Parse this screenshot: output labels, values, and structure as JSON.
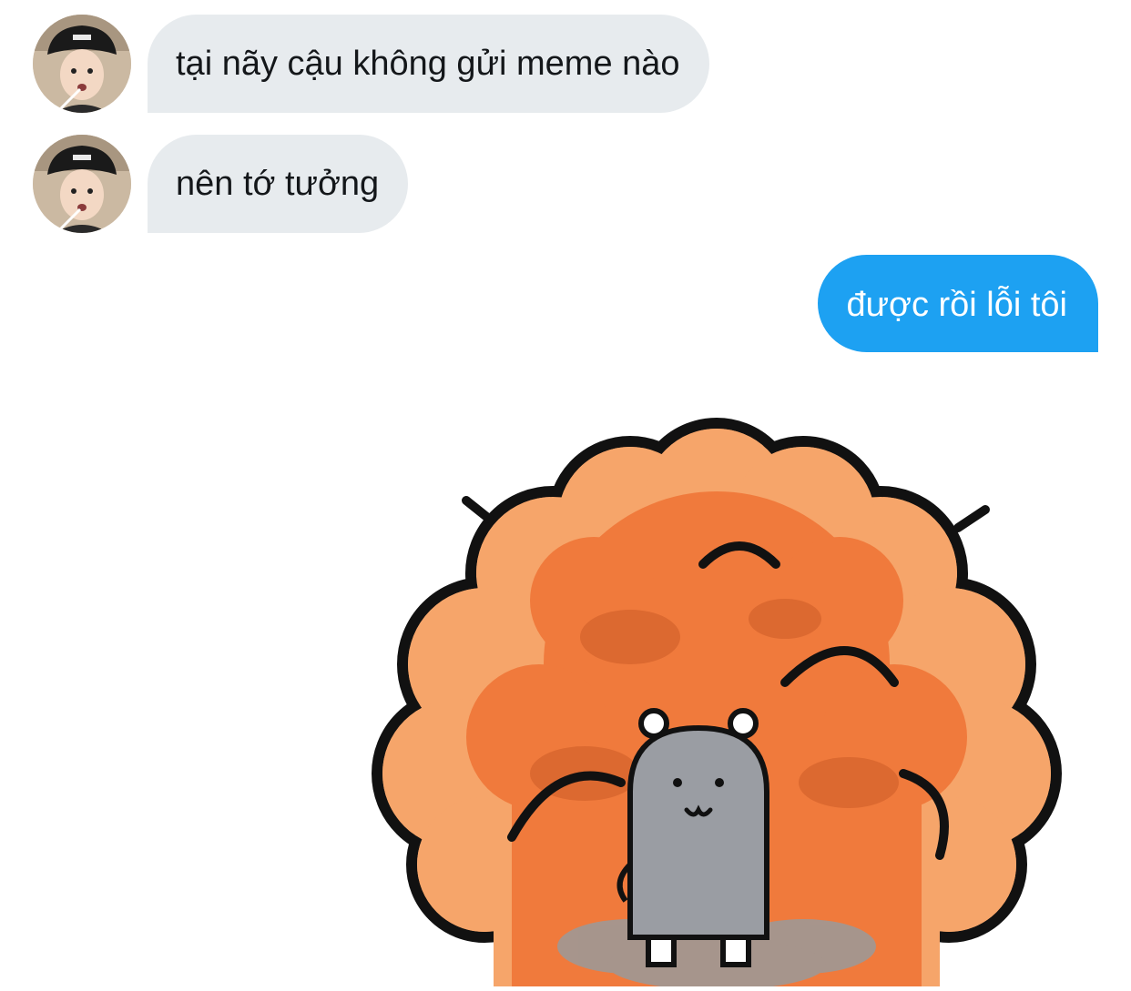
{
  "messages": [
    {
      "sender": "other",
      "text": "tại nãy cậu không gửi meme nào"
    },
    {
      "sender": "other",
      "text": "nên tớ tưởng"
    },
    {
      "sender": "me",
      "text": "được rồi lỗi tôi"
    },
    {
      "sender": "me",
      "type": "sticker",
      "sticker": "explosion-bear"
    }
  ],
  "colors": {
    "received_bubble": "#e7ebee",
    "sent_bubble": "#1da1f2",
    "received_text": "#14171a",
    "sent_text": "#ffffff"
  }
}
